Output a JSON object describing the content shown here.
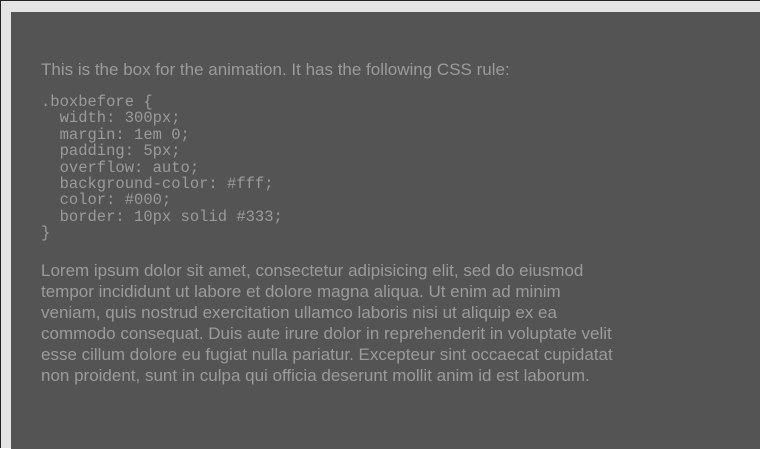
{
  "box": {
    "intro": "This is the box for the animation. It has the following CSS rule:",
    "code_lines": [
      ".boxbefore {",
      "  width: 300px;",
      "  margin: 1em 0;",
      "  padding: 5px;",
      "  overflow: auto;",
      "  background-color: #fff;",
      "  color: #000;",
      "  border: 10px solid #333;",
      "}"
    ],
    "lorem_lines": [
      "Lorem ipsum dolor sit amet, consectetur adipisicing elit, sed do eiusmod",
      "tempor incididunt ut labore et dolore magna aliqua. Ut enim ad minim",
      "veniam, quis nostrud exercitation ullamco laboris nisi ut aliquip ex ea",
      "commodo consequat. Duis aute irure dolor in reprehenderit in voluptate velit",
      "esse cillum dolore eu fugiat nulla pariatur. Excepteur sint occaecat cupidatat",
      "non proident, sunt in culpa qui officia deserunt mollit anim id est laborum."
    ]
  },
  "colors": {
    "box_background": "#545454",
    "text": "#9b9b9b",
    "frame_background": "#e4e4e4"
  }
}
